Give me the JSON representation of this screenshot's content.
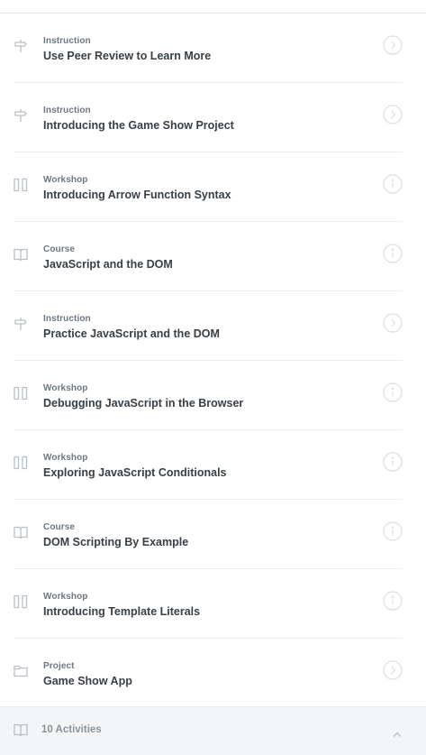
{
  "activities": [
    {
      "type": "Instruction",
      "title": "Use Peer Review to Learn More",
      "type_icon": "signpost-icon",
      "status_icon": "chevron-circle-icon"
    },
    {
      "type": "Instruction",
      "title": "Introducing the Game Show Project",
      "type_icon": "signpost-icon",
      "status_icon": "chevron-circle-icon"
    },
    {
      "type": "Workshop",
      "title": "Introducing Arrow Function Syntax",
      "type_icon": "workshop-icon",
      "status_icon": "info-circle-icon"
    },
    {
      "type": "Course",
      "title": "JavaScript and the DOM",
      "type_icon": "book-icon",
      "status_icon": "info-circle-icon"
    },
    {
      "type": "Instruction",
      "title": "Practice JavaScript and the DOM",
      "type_icon": "signpost-icon",
      "status_icon": "chevron-circle-icon"
    },
    {
      "type": "Workshop",
      "title": "Debugging JavaScript in the Browser",
      "type_icon": "workshop-icon",
      "status_icon": "info-circle-icon"
    },
    {
      "type": "Workshop",
      "title": "Exploring JavaScript Conditionals",
      "type_icon": "workshop-icon",
      "status_icon": "info-circle-icon"
    },
    {
      "type": "Course",
      "title": "DOM Scripting By Example",
      "type_icon": "book-icon",
      "status_icon": "info-circle-icon"
    },
    {
      "type": "Workshop",
      "title": "Introducing Template Literals",
      "type_icon": "workshop-icon",
      "status_icon": "info-circle-icon"
    },
    {
      "type": "Project",
      "title": "Game Show App",
      "type_icon": "folder-icon",
      "status_icon": "chevron-circle-icon"
    }
  ],
  "footer": {
    "label": "10 Activities",
    "icon": "book-icon",
    "toggle_icon": "chevron-up-icon"
  },
  "colors": {
    "icon": "#b9c0c5",
    "status_ring": "#dfe3e6",
    "text": "#384047",
    "type_text": "#6b7882",
    "footer_bg": "#f4f5f6"
  }
}
